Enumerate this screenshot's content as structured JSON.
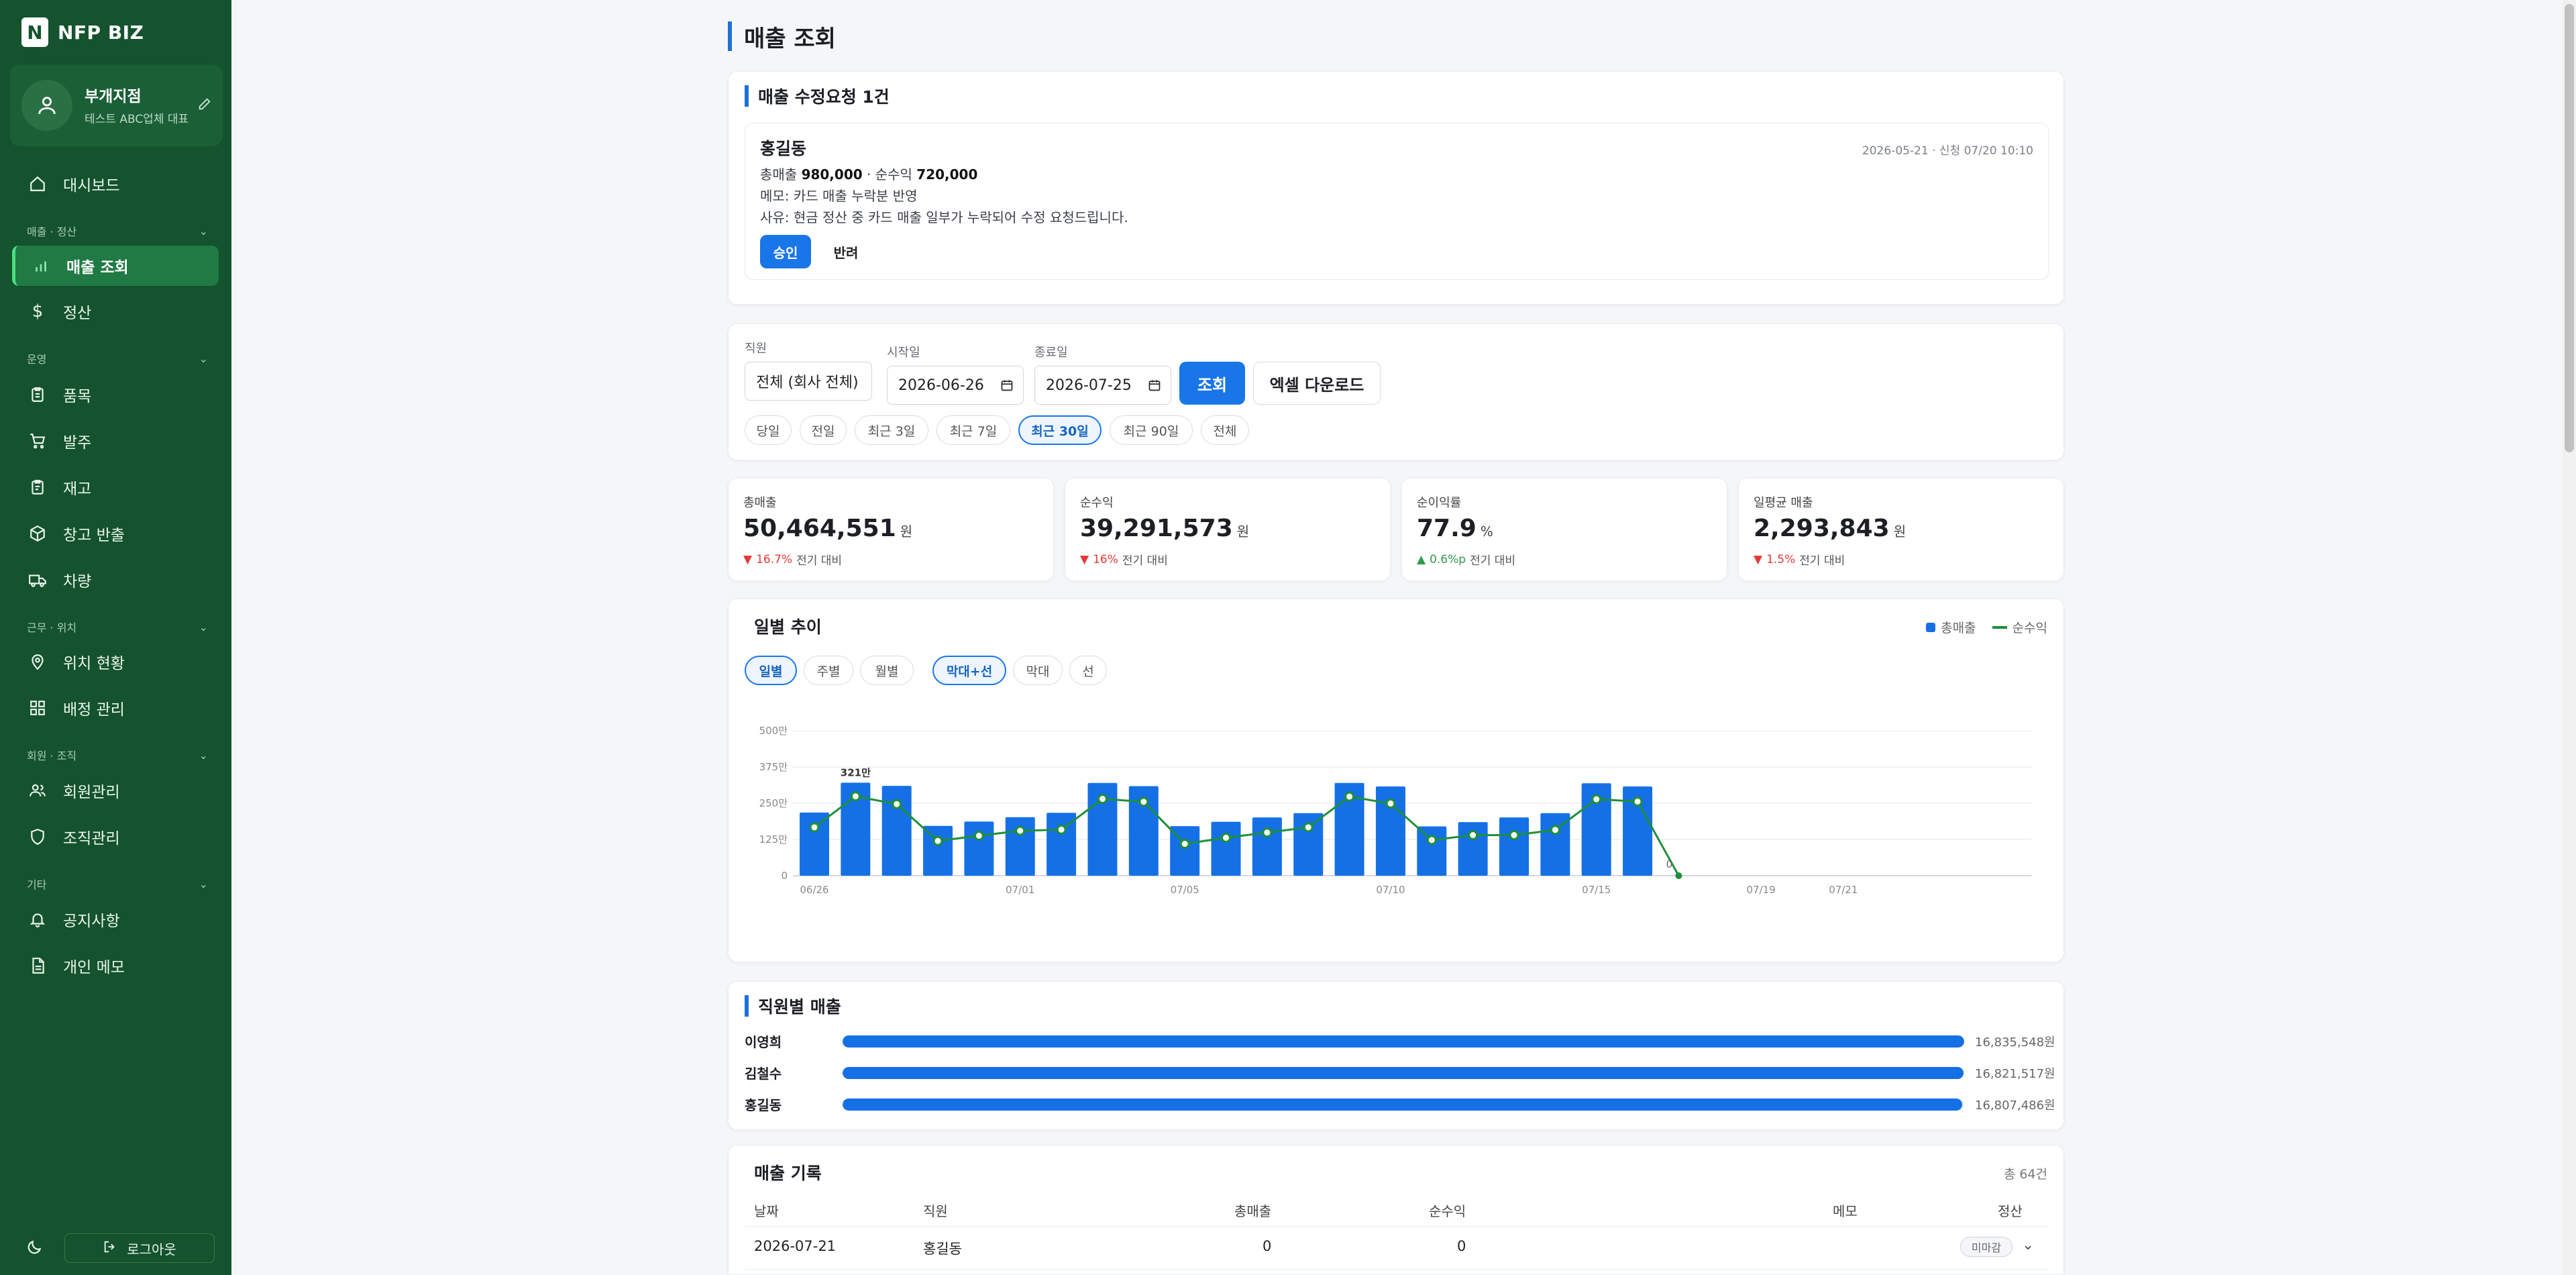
{
  "app": {
    "brand": "NFP BIZ",
    "logo_letter": "N"
  },
  "profile": {
    "name": "부개지점",
    "sub": "테스트 ABC업체 대표"
  },
  "nav": {
    "dashboard": "대시보드",
    "section_sales": "매출 · 정산",
    "sales": "매출 조회",
    "settlement": "정산",
    "section_ops": "운영",
    "items": "품목",
    "orders": "발주",
    "stock": "재고",
    "returns": "창고 반출",
    "vehicles": "차량",
    "section_work": "근무 · 위치",
    "location": "위치 현황",
    "assign": "배정 관리",
    "section_org": "회원 · 조직",
    "members": "회원관리",
    "org": "조직관리",
    "section_etc": "기타",
    "notice": "공지사항",
    "memo": "개인 메모"
  },
  "logout_label": "로그아웃",
  "page_title": "매출 조회",
  "request": {
    "title": "매출 수정요청 1건",
    "name": "홍길동",
    "date": "2026-05-21 · 신청 07/20 10:10",
    "total_label": "총매출",
    "total_value": "980,000",
    "net_label": "· 순수익",
    "net_value": "720,000",
    "memo": "메모: 카드 매출 누락분 반영",
    "reason": "사유: 현금 정산 중 카드 매출 일부가 누락되어 수정 요청드립니다.",
    "approve": "승인",
    "reject": "반려"
  },
  "filter": {
    "staff_label": "직원",
    "staff_value": "전체 (회사 전체)",
    "start_label": "시작일",
    "start_value": "2026-06-26",
    "end_label": "종료일",
    "end_value": "2026-07-25",
    "search": "조회",
    "excel": "엑셀 다운로드",
    "quick": [
      "당일",
      "전일",
      "최근 3일",
      "최근 7일",
      "최근 30일",
      "최근 90일",
      "전체"
    ],
    "quick_active": "최근 30일"
  },
  "stats": [
    {
      "label": "총매출",
      "value": "50,464,551",
      "unit": "원",
      "delta": "16.7%",
      "dir": "down",
      "note": "전기 대비"
    },
    {
      "label": "순수익",
      "value": "39,291,573",
      "unit": "원",
      "delta": "16%",
      "dir": "down",
      "note": "전기 대비"
    },
    {
      "label": "순이익률",
      "value": "77.9",
      "unit": "%",
      "delta": "0.6%p",
      "dir": "up",
      "note": "전기 대비"
    },
    {
      "label": "일평균 매출",
      "value": "2,293,843",
      "unit": "원",
      "delta": "1.5%",
      "dir": "down",
      "note": "전기 대비"
    }
  ],
  "trend": {
    "title": "일별 추이",
    "legend_total": "총매출",
    "legend_net": "순수익",
    "period_tabs": [
      "일별",
      "주별",
      "월별"
    ],
    "period_active": "일별",
    "type_tabs": [
      "막대+선",
      "막대",
      "선"
    ],
    "type_active": "막대+선",
    "colors": {
      "bar": "#1570e6",
      "line": "#1f8f3a"
    }
  },
  "chart_data": {
    "type": "bar",
    "x": [
      "06/26",
      "06/27",
      "06/28",
      "06/29",
      "06/30",
      "07/01",
      "07/02",
      "07/03",
      "07/04",
      "07/05",
      "07/06",
      "07/07",
      "07/08",
      "07/09",
      "07/10",
      "07/11",
      "07/12",
      "07/13",
      "07/14",
      "07/15",
      "07/16",
      "07/17",
      "07/18",
      "07/19",
      "07/20",
      "07/21"
    ],
    "x_tick_labels": [
      "06/26",
      "07/01",
      "07/05",
      "07/10",
      "07/15",
      "07/19",
      "07/21"
    ],
    "y_ticks": [
      "0",
      "125만",
      "250만",
      "375만",
      "500만"
    ],
    "ylim": [
      0,
      5000000
    ],
    "series": [
      {
        "name": "총매출",
        "kind": "bar",
        "values": [
          2180000,
          3210000,
          3100000,
          1720000,
          1870000,
          2020000,
          2170000,
          3200000,
          3090000,
          1710000,
          1860000,
          2010000,
          2160000,
          3200000,
          3080000,
          1700000,
          1850000,
          2010000,
          2160000,
          3190000,
          3080000,
          0,
          0,
          0,
          0,
          0
        ]
      },
      {
        "name": "순수익",
        "kind": "line",
        "values": [
          1670000,
          2740000,
          2470000,
          1200000,
          1380000,
          1550000,
          1590000,
          2650000,
          2550000,
          1100000,
          1310000,
          1490000,
          1670000,
          2730000,
          2490000,
          1230000,
          1400000,
          1400000,
          1580000,
          2640000,
          2560000,
          0,
          0,
          0,
          0,
          0
        ]
      }
    ],
    "annotations": [
      "321만",
      "0"
    ]
  },
  "employees": {
    "title": "직원별 매출",
    "rows": [
      {
        "name": "이영희",
        "value": "16,835,548원",
        "ratio": 1.0
      },
      {
        "name": "김철수",
        "value": "16,821,517원",
        "ratio": 0.9992
      },
      {
        "name": "홍길동",
        "value": "16,807,486원",
        "ratio": 0.9983
      }
    ]
  },
  "records": {
    "title": "매출 기록",
    "total": "총 64건",
    "headers": [
      "날짜",
      "직원",
      "총매출",
      "순수익",
      "메모",
      "정산"
    ],
    "row": {
      "date": "2026-07-21",
      "staff": "홍길동",
      "total": "0",
      "net": "0",
      "status": "미마감"
    }
  }
}
